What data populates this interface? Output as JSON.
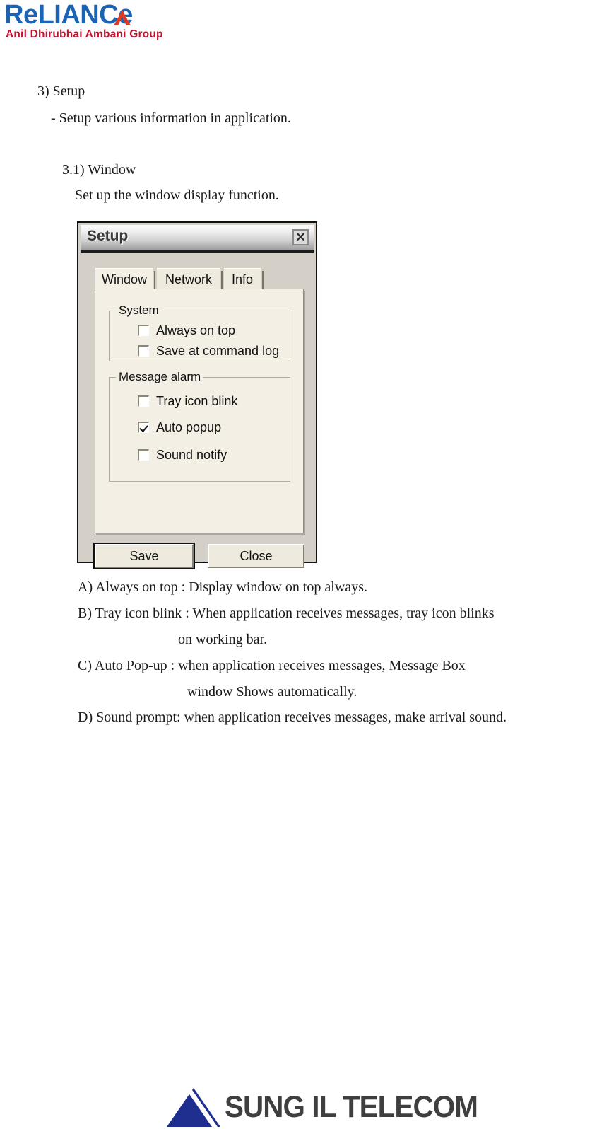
{
  "header": {
    "brand": "RELIANCE",
    "brand_display": "ReLIANCe",
    "tagline": "Anil Dhirubhai Ambani Group",
    "brand_color": "#1b63b5",
    "tagline_color": "#c8102e",
    "chevron_color": "#e03a26"
  },
  "document": {
    "heading_3": "3) Setup",
    "heading_3_desc": "- Setup various information in application.",
    "heading_3_1": "3.1) Window",
    "heading_3_1_desc": "Set up the window display function.",
    "descriptions": {
      "a": "A) Always on top : Display window on top always.",
      "b_line1": "B) Tray icon blink : When application receives messages, tray icon blinks",
      "b_line2": "on working bar.",
      "c_line1": "C) Auto Pop-up : when application receives messages, Message Box",
      "c_line2": "window Shows automatically.",
      "d": "D) Sound prompt: when application receives messages, make arrival sound."
    }
  },
  "dialog": {
    "title": "Setup",
    "close_glyph": "☒",
    "close_icon_name": "close-icon",
    "tabs": [
      {
        "label": "Window",
        "active": true
      },
      {
        "label": "Network",
        "active": false
      },
      {
        "label": "Info",
        "active": false
      }
    ],
    "groups": [
      {
        "label": "System",
        "checkboxes": [
          {
            "label": "Always on top",
            "checked": false
          },
          {
            "label": "Save at command log",
            "checked": false
          }
        ]
      },
      {
        "label": "Message alarm",
        "checkboxes": [
          {
            "label": "Tray icon blink",
            "checked": false
          },
          {
            "label": "Auto popup",
            "checked": true
          },
          {
            "label": "Sound notify",
            "checked": false
          }
        ]
      }
    ],
    "buttons": {
      "save": "Save",
      "close": "Close"
    },
    "colors": {
      "window_face": "#d4d0c8",
      "panel_face": "#f3efe4",
      "titlebar_top": "#fdfdfd",
      "titlebar_bottom": "#9a9a9a"
    }
  },
  "footer": {
    "company": "SUNG IL TELECOM",
    "company_part1": "SUNG",
    "company_part2": "IL TELECOM",
    "logo_color": "#1f2f8f",
    "text_color": "#3f3f3f"
  }
}
